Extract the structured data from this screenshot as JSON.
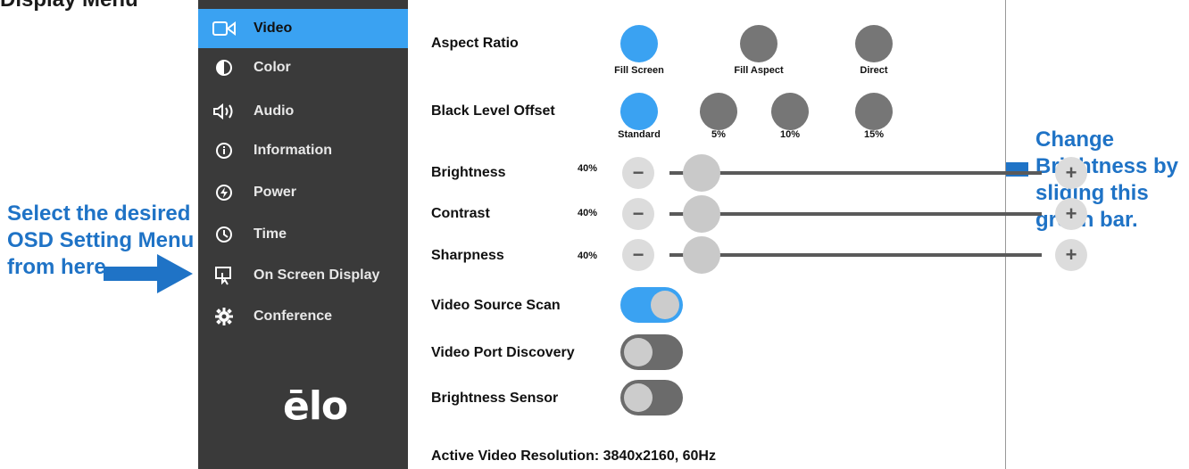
{
  "page_top_text": "Display Menu",
  "annotations": {
    "left_note": "Select the desired OSD Setting Menu from here",
    "right_note": "Change Brightness by sliding this green bar.",
    "accent_color": "#1f73c6"
  },
  "sidebar": {
    "items": [
      {
        "label": "Video",
        "icon": "video-camera-icon",
        "active": true
      },
      {
        "label": "Color",
        "icon": "half-circle-icon",
        "active": false
      },
      {
        "label": "Audio",
        "icon": "speaker-icon",
        "active": false
      },
      {
        "label": "Information",
        "icon": "info-icon",
        "active": false
      },
      {
        "label": "Power",
        "icon": "power-icon",
        "active": false
      },
      {
        "label": "Time",
        "icon": "clock-icon",
        "active": false
      },
      {
        "label": "On Screen Display",
        "icon": "osd-touch-icon",
        "active": false
      },
      {
        "label": "Conference",
        "icon": "gear-icon",
        "active": false
      }
    ],
    "logo": "ēlo",
    "active_color": "#3aa2f2",
    "background": "#3a3a3a"
  },
  "video": {
    "aspect_ratio": {
      "label": "Aspect Ratio",
      "options": [
        "Fill Screen",
        "Fill Aspect",
        "Direct"
      ],
      "selected": "Fill Screen"
    },
    "black_level": {
      "label": "Black Level Offset",
      "options": [
        "Standard",
        "5%",
        "10%",
        "15%"
      ],
      "selected": "Standard"
    },
    "sliders": [
      {
        "label": "Brightness",
        "value": "40%",
        "level": 0.0
      },
      {
        "label": "Contrast",
        "value": "40%",
        "level": 0.0
      },
      {
        "label": "Sharpness",
        "value": "40%",
        "level": 0.0
      }
    ],
    "toggles": [
      {
        "label": "Video Source Scan",
        "on": true
      },
      {
        "label": "Video Port Discovery",
        "on": false
      },
      {
        "label": "Brightness Sensor",
        "on": false
      }
    ],
    "resolution": "Active Video Resolution: 3840x2160, 60Hz"
  }
}
